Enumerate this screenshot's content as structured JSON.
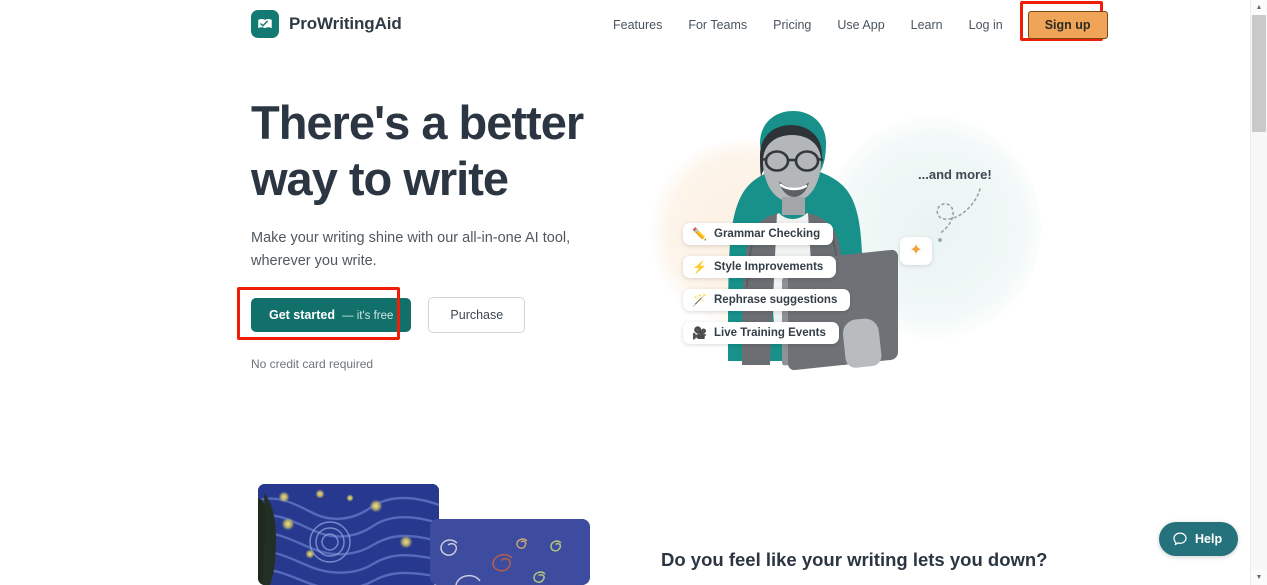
{
  "header": {
    "brand": {
      "name": "ProWritingAid",
      "logo_icon": "book-check-icon",
      "logo_color": "#127a72"
    },
    "nav_links": [
      {
        "label": "Features"
      },
      {
        "label": "For Teams"
      },
      {
        "label": "Pricing"
      },
      {
        "label": "Use App"
      },
      {
        "label": "Learn"
      },
      {
        "label": "Log in"
      }
    ],
    "signup": {
      "label": "Sign up",
      "bg_color": "#efa457",
      "highlight_color": "#f01d08"
    }
  },
  "hero": {
    "title_line1": "There's a better",
    "title_line2": "way to write",
    "subtitle": "Make your writing shine with our all-in-one AI tool, wherever you write.",
    "cta_primary": {
      "label": "Get started",
      "suffix": "— it's free",
      "bg_color": "#12706a",
      "highlight_color": "#f01d08"
    },
    "cta_secondary": {
      "label": "Purchase"
    },
    "note": "No credit card required",
    "and_more_label": "...and more!",
    "sparkle_icon": "sparkle-icon",
    "feature_chips": [
      {
        "icon": "pencil-icon",
        "glyph": "✏️",
        "label": "Grammar Checking"
      },
      {
        "icon": "lightning-bolt-icon",
        "glyph": "⚡",
        "label": "Style Improvements"
      },
      {
        "icon": "magic-wand-icon",
        "glyph": "🪄",
        "label": "Rephrase suggestions"
      },
      {
        "icon": "movie-camera-icon",
        "glyph": "🎥",
        "label": "Live Training Events"
      }
    ]
  },
  "lower_section": {
    "heading": "Do you feel like your writing lets you down?",
    "artwork_left_name": "starry-night-painting",
    "artwork_right_name": "blue-doodle-panel"
  },
  "help_widget": {
    "label": "Help",
    "icon": "chat-bubble-icon",
    "bg_color": "#26727c"
  },
  "scrollbar": {
    "up_arrow": "▲",
    "down_arrow": "▼"
  }
}
